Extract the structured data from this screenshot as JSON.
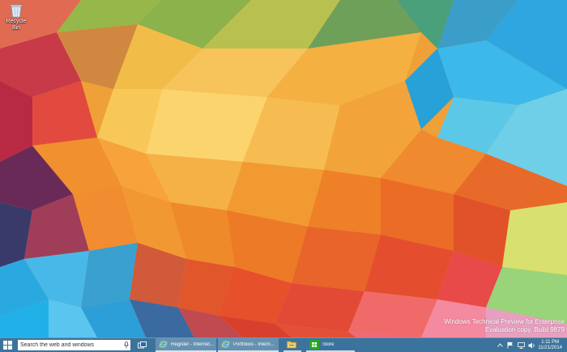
{
  "desktop": {
    "icons": [
      {
        "label": "Recycle Bin",
        "icon": "recycle-bin-icon"
      }
    ],
    "watermark": {
      "line1": "Windows Technical Preview for Enterprise",
      "line2": "Evaluation copy. Build 9879"
    }
  },
  "taskbar": {
    "start_icon": "windows-logo-icon",
    "search": {
      "placeholder": "Search the web and windows"
    },
    "apps": [
      {
        "label": "Register - Internet...",
        "icon": "internet-explorer-icon",
        "active": true
      },
      {
        "label": "Portfolios - Intern...",
        "icon": "internet-explorer-icon",
        "active": true
      },
      {
        "label": "",
        "icon": "file-explorer-icon",
        "active": false
      },
      {
        "label": "Store",
        "icon": "store-icon",
        "active": false
      }
    ],
    "clock": {
      "time": "1:11 PM",
      "date": "11/21/2014"
    }
  },
  "colors": {
    "taskbar": "#226caa",
    "ie_blue": "#1a9ee0",
    "store_green": "#2aa52a",
    "explorer_yellow": "#f2c54a"
  }
}
